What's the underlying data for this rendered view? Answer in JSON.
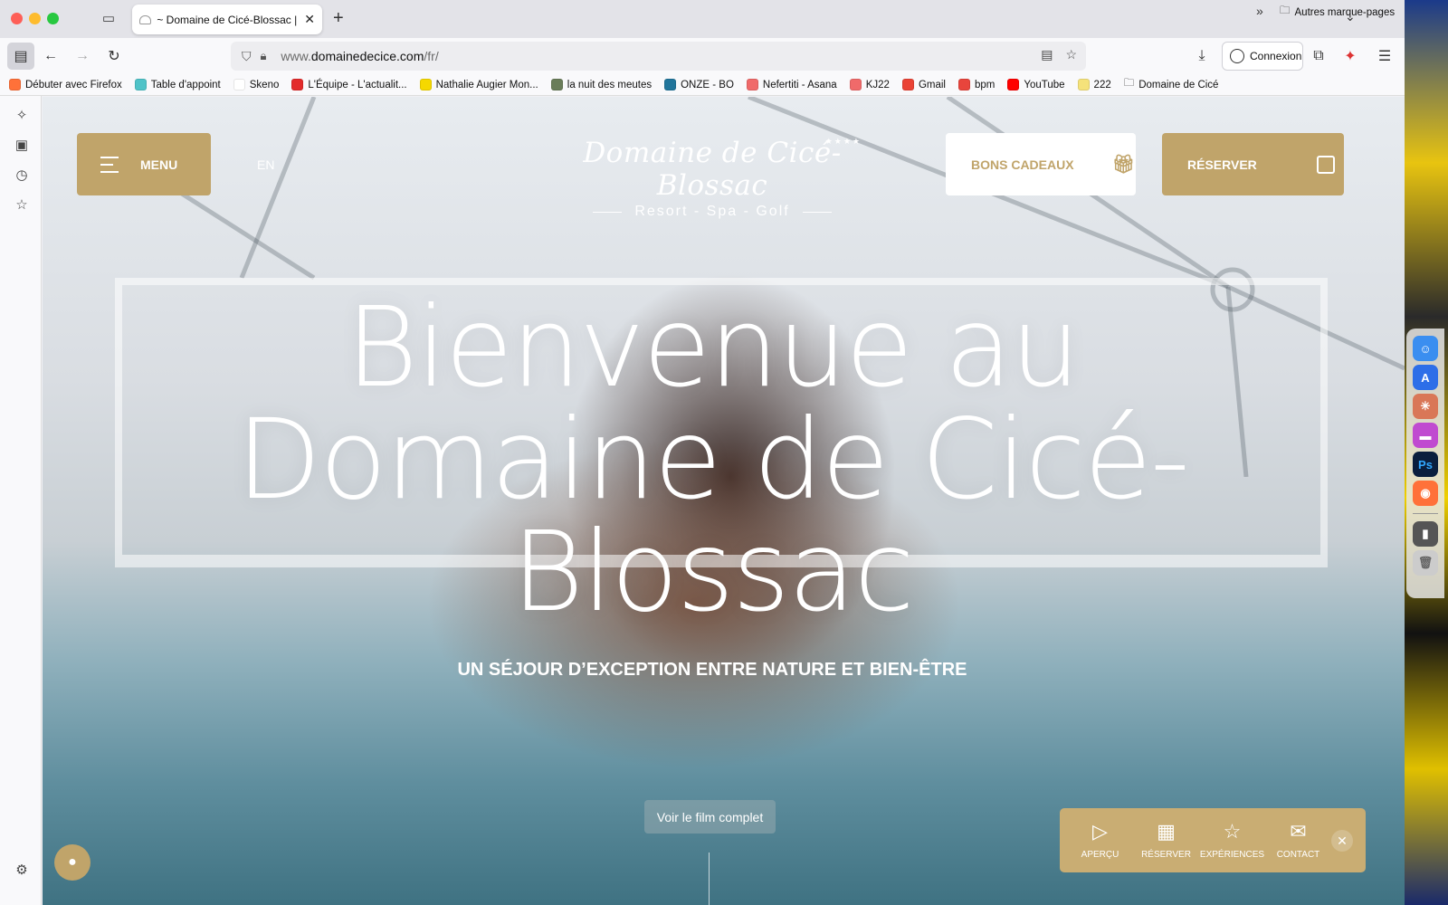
{
  "browser": {
    "tab_title": "~ Domaine de Cicé-Blossac | Hô",
    "url_prefix": "www.",
    "url_domain": "domainedecice.com",
    "url_path": "/fr/",
    "connexion_label": "Connexion",
    "bookmarks": [
      {
        "label": "Débuter avec Firefox",
        "color": "#ff7139"
      },
      {
        "label": "Table d'appoint",
        "color": "#4fc3c8"
      },
      {
        "label": "Skeno",
        "color": "#ffffff"
      },
      {
        "label": "L'Équipe - L'actualit...",
        "color": "#e32b2b"
      },
      {
        "label": "Nathalie Augier Mon...",
        "color": "#f5d800"
      },
      {
        "label": "la nuit des meutes",
        "color": "#6a7d5a"
      },
      {
        "label": "ONZE - BO",
        "color": "#21759b"
      },
      {
        "label": "Nefertiti - Asana",
        "color": "#f06a6a"
      },
      {
        "label": "KJ22",
        "color": "#f06a6a"
      },
      {
        "label": "Gmail",
        "color": "#ea4335"
      },
      {
        "label": "bpm",
        "color": "#e8453c"
      },
      {
        "label": "YouTube",
        "color": "#ff0000"
      },
      {
        "label": "222",
        "color": "#f5e27a"
      },
      {
        "label": "Domaine de Cicé",
        "color": "folder"
      }
    ],
    "bookmarks_other": "Autres marque-pages"
  },
  "site": {
    "menu_label": "MENU",
    "lang_label": "EN",
    "logo_name": "Domaine de Cicé-Blossac",
    "logo_stars": "★★★★",
    "logo_tagline": "Resort - Spa - Golf",
    "gift_label": "BONS CADEAUX",
    "reserve_label": "RÉSERVER",
    "hero_line1": "Bienvenue au",
    "hero_line2": "Domaine de Cicé-",
    "hero_line3": "Blossac",
    "hero_subtitle": "UN SÉJOUR D’EXCEPTION ENTRE NATURE ET BIEN-ÊTRE",
    "film_label": "Voir le film complet",
    "accent_color": "#c0a46a"
  },
  "bottom_nav": [
    {
      "label": "APERÇU",
      "icon": "play-icon"
    },
    {
      "label": "RÉSERVER",
      "icon": "calendar-icon"
    },
    {
      "label": "EXPÉRIENCES",
      "icon": "star-icon"
    },
    {
      "label": "CONTACT",
      "icon": "mail-icon"
    }
  ]
}
